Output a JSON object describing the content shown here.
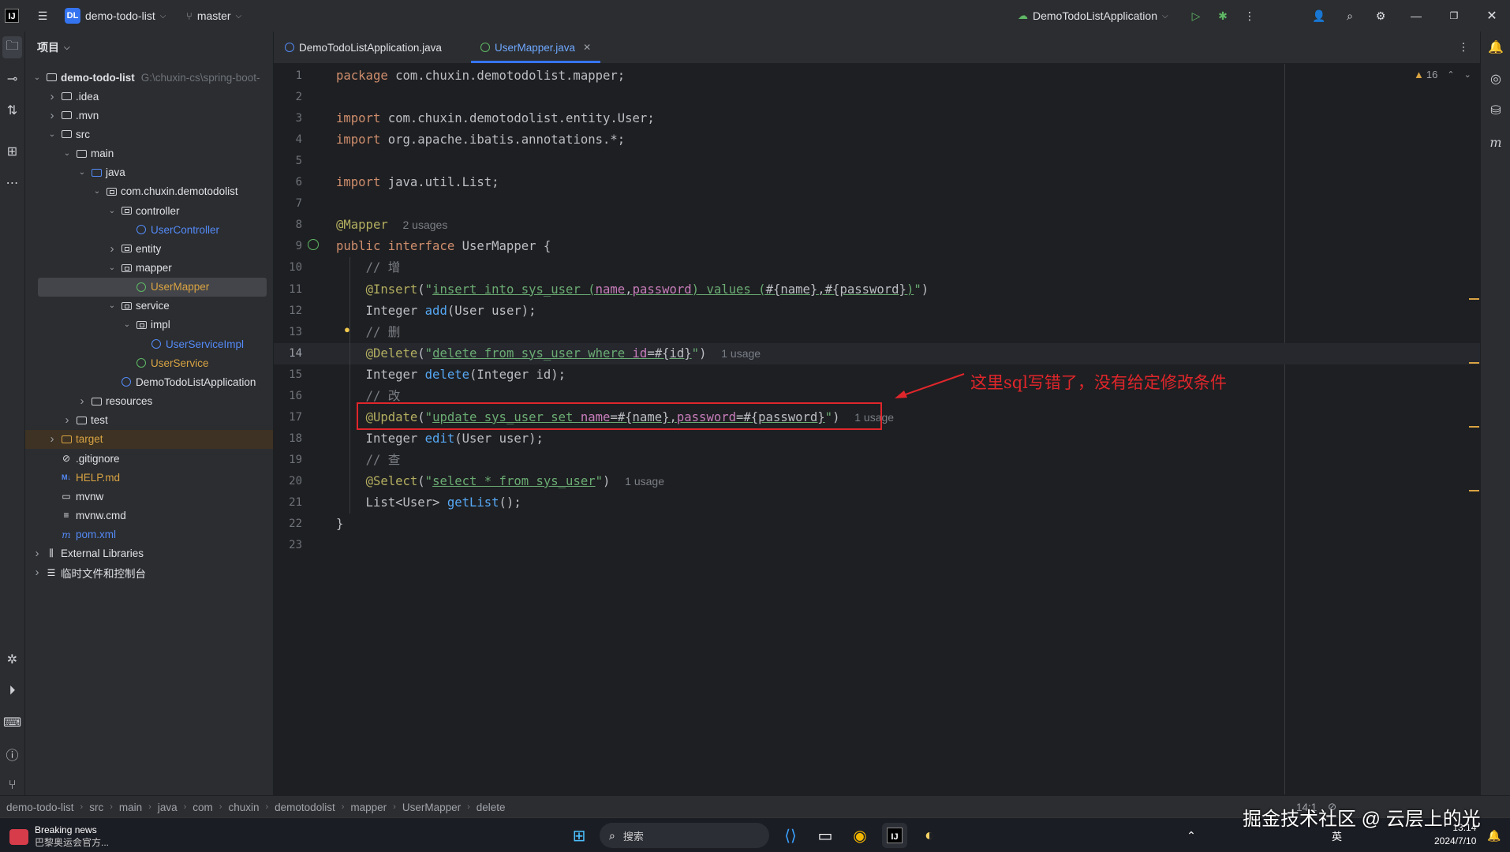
{
  "titlebar": {
    "logo": "IJ",
    "project_badge": "DL",
    "project_name": "demo-todo-list",
    "branch": "master",
    "run_config": "DemoTodoListApplication"
  },
  "project_panel": {
    "header": "项目",
    "tree": [
      {
        "label": "demo-todo-list",
        "path": "G:\\chuxin-cs\\spring-boot-",
        "indent": 0,
        "arrow": "down",
        "icon": "module",
        "bold": true
      },
      {
        "label": ".idea",
        "indent": 1,
        "arrow": "right",
        "icon": "folder"
      },
      {
        "label": ".mvn",
        "indent": 1,
        "arrow": "right",
        "icon": "folder"
      },
      {
        "label": "src",
        "indent": 1,
        "arrow": "down",
        "icon": "folder"
      },
      {
        "label": "main",
        "indent": 2,
        "arrow": "down",
        "icon": "folder"
      },
      {
        "label": "java",
        "indent": 3,
        "arrow": "down",
        "icon": "folder-src"
      },
      {
        "label": "com.chuxin.demotodolist",
        "indent": 4,
        "arrow": "down",
        "icon": "package"
      },
      {
        "label": "controller",
        "indent": 5,
        "arrow": "down",
        "icon": "package"
      },
      {
        "label": "UserController",
        "indent": 6,
        "arrow": "",
        "icon": "class",
        "color": "#548af7"
      },
      {
        "label": "entity",
        "indent": 5,
        "arrow": "right",
        "icon": "package"
      },
      {
        "label": "mapper",
        "indent": 5,
        "arrow": "down",
        "icon": "package"
      },
      {
        "label": "UserMapper",
        "indent": 6,
        "arrow": "",
        "icon": "interface",
        "color": "#d9a343",
        "selected": true
      },
      {
        "label": "service",
        "indent": 5,
        "arrow": "down",
        "icon": "package"
      },
      {
        "label": "impl",
        "indent": 6,
        "arrow": "down",
        "icon": "package"
      },
      {
        "label": "UserServiceImpl",
        "indent": 7,
        "arrow": "",
        "icon": "class",
        "color": "#548af7"
      },
      {
        "label": "UserService",
        "indent": 6,
        "arrow": "",
        "icon": "interface",
        "color": "#d9a343"
      },
      {
        "label": "DemoTodoListApplication",
        "indent": 5,
        "arrow": "",
        "icon": "class"
      },
      {
        "label": "resources",
        "indent": 3,
        "arrow": "right",
        "icon": "folder"
      },
      {
        "label": "test",
        "indent": 2,
        "arrow": "right",
        "icon": "folder"
      },
      {
        "label": "target",
        "indent": 1,
        "arrow": "right",
        "icon": "folder-excluded",
        "color": "#d9a343",
        "excluded": true
      },
      {
        "label": ".gitignore",
        "indent": 1,
        "arrow": "",
        "icon": "ignore"
      },
      {
        "label": "HELP.md",
        "indent": 1,
        "arrow": "",
        "icon": "md",
        "color": "#d9a343"
      },
      {
        "label": "mvnw",
        "indent": 1,
        "arrow": "",
        "icon": "file"
      },
      {
        "label": "mvnw.cmd",
        "indent": 1,
        "arrow": "",
        "icon": "lines"
      },
      {
        "label": "pom.xml",
        "indent": 1,
        "arrow": "",
        "icon": "maven",
        "color": "#548af7"
      },
      {
        "label": "External Libraries",
        "indent": 0,
        "arrow": "right",
        "icon": "libs"
      },
      {
        "label": "临时文件和控制台",
        "indent": 0,
        "arrow": "right",
        "icon": "scratch"
      }
    ]
  },
  "tabs": [
    {
      "label": "DemoTodoListApplication.java",
      "active": false
    },
    {
      "label": "UserMapper.java",
      "active": true
    }
  ],
  "editor": {
    "current_line": 14,
    "inspection_count": "16",
    "lines": [
      {
        "n": 1,
        "html": "<span class='kw'>package</span> com.chuxin.demotodolist.mapper;"
      },
      {
        "n": 2,
        "html": ""
      },
      {
        "n": 3,
        "html": "<span class='kw'>import</span> com.chuxin.demotodolist.entity.User;"
      },
      {
        "n": 4,
        "html": "<span class='kw'>import</span> org.apache.ibatis.annotations.*;"
      },
      {
        "n": 5,
        "html": ""
      },
      {
        "n": 6,
        "html": "<span class='kw'>import</span> java.util.List;"
      },
      {
        "n": 7,
        "html": ""
      },
      {
        "n": 8,
        "html": "<span class='ann'>@Mapper</span>  <span class='hint'>2 usages</span>"
      },
      {
        "n": 9,
        "html": "<span class='kw'>public interface</span> UserMapper {"
      },
      {
        "n": 10,
        "html": "    <span class='cm'>// 增</span>"
      },
      {
        "n": 11,
        "html": "    <span class='ann'>@Insert</span>(<span class='sq'>\"</span><span class='sqk'>insert into sys_user (</span><span class='sqv'>name</span><span class='sqt'>,</span><span class='sqv'>password</span><span class='sqk'>) values (</span><span class='sqt'>#{name},#{password}</span><span class='sqk'>)</span><span class='sq'>\"</span>)"
      },
      {
        "n": 12,
        "html": "    Integer <span class='fn'>add</span>(User user);"
      },
      {
        "n": 13,
        "html": "    <span class='cm'>// 删</span>"
      },
      {
        "n": 14,
        "html": "    <span class='ann'>@Delete</span>(<span class='sq'>\"</span><span class='sqk'>delete from sys_user where </span><span class='sqv'>id</span><span class='sqt'>=#{id}</span><span class='sq'>\"</span>)  <span class='hint'>1 usage</span>"
      },
      {
        "n": 15,
        "html": "    Integer <span class='fn'>delete</span>(Integer id);"
      },
      {
        "n": 16,
        "html": "    <span class='cm'>// 改</span>"
      },
      {
        "n": 17,
        "html": "    <span class='ann'>@Update</span>(<span class='sq'>\"</span><span class='sqk'>update sys_user set </span><span class='sqv'>name</span><span class='sqt'>=#{name},</span><span class='sqv'>password</span><span class='sqt'>=#{password}</span><span class='sq'>\"</span>)  <span class='hint'>1 usage</span>"
      },
      {
        "n": 18,
        "html": "    Integer <span class='fn'>edit</span>(User user);"
      },
      {
        "n": 19,
        "html": "    <span class='cm'>// 查</span>"
      },
      {
        "n": 20,
        "html": "    <span class='ann'>@Select</span>(<span class='sq'>\"</span><span class='sqk'>select * from sys_user</span><span class='sq'>\"</span>)  <span class='hint'>1 usage</span>"
      },
      {
        "n": 21,
        "html": "    List&lt;User&gt; <span class='fn'>getList</span>();"
      },
      {
        "n": 22,
        "html": "}"
      },
      {
        "n": 23,
        "html": ""
      }
    ]
  },
  "annotation": {
    "text": "这里sql写错了，没有给定修改条件",
    "color": "#e0262b"
  },
  "status": {
    "breadcrumbs": [
      "demo-todo-list",
      "src",
      "main",
      "java",
      "com",
      "chuxin",
      "demotodolist",
      "mapper",
      "UserMapper",
      "delete"
    ],
    "position": "14:1"
  },
  "taskbar": {
    "news_title": "Breaking news",
    "news_sub": "巴黎奥运会官方...",
    "search": "搜索",
    "ime": "英",
    "time": "13:14",
    "date": "2024/7/10"
  },
  "watermark": "掘金技术社区 @ 云层上的光"
}
